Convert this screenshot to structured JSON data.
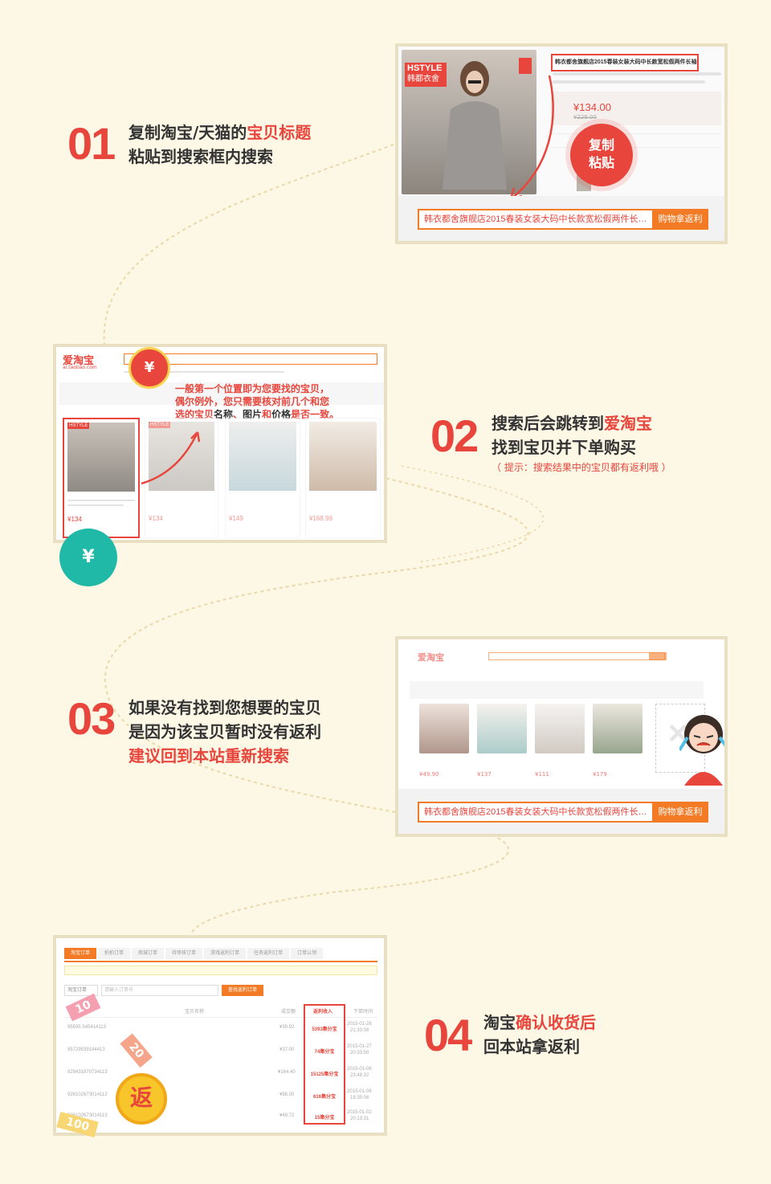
{
  "colors": {
    "accent": "#e8463c",
    "orange": "#f47b26",
    "background": "#fdf7e6",
    "frame": "#e9dfc2",
    "teal": "#20b9a8"
  },
  "step1": {
    "number": "01",
    "line1_prefix": "复制淘宝/天猫的",
    "line1_highlight": "宝贝标题",
    "line2": "粘贴到搜索框内搜索",
    "screenshot": {
      "brand_line1": "HSTYLE",
      "brand_line2": "韩都衣舍",
      "product_title": "韩衣都舍旗舰店2015春装女装大码中长款宽松假两件长袖针织衫潮",
      "price": "¥134.00",
      "old_price": "¥228.00",
      "copy_label_line1": "复制",
      "copy_label_line2": "粘贴",
      "search_value": "韩衣都舍旗舰店2015春装女装大码中长款宽松假两件长袖针织...",
      "search_button": "购物拿返利"
    }
  },
  "step2": {
    "number": "02",
    "line1_prefix": "搜索后会跳转到",
    "line1_highlight": "爱淘宝",
    "line2": "找到宝贝并下单购买",
    "hint": "（ 提示：搜索结果中的宝贝都有返利哦 ）",
    "screenshot": {
      "logo": "爱淘宝",
      "logo_sub": "ai.taobao.com",
      "note_line1": "一般第一个位置即为您要找的宝贝，",
      "note_line2": "偶尔例外，您只需要核对前几个和您",
      "note_line3_a": "选的宝贝",
      "note_line3_b": "名称",
      "note_line3_c": "、",
      "note_line3_d": "图片",
      "note_line3_e": "和",
      "note_line3_f": "价格",
      "note_line3_g": "是否一致。",
      "products": [
        {
          "price": "¥134",
          "brand": "HSTYLE"
        },
        {
          "price": "¥134",
          "brand": "HSTYLE"
        },
        {
          "price": "¥149",
          "brand": ""
        },
        {
          "price": "¥168.99",
          "brand": ""
        }
      ]
    }
  },
  "step3": {
    "number": "03",
    "line1": "如果没有找到您想要的宝贝",
    "line2": "是因为该宝贝暂时没有返利",
    "line3": "建议回到本站重新搜索",
    "screenshot": {
      "logo": "爱淘宝",
      "search_value": "韩衣都舍旗舰店2015春装女装大码中长款宽松假两件长袖针织...",
      "search_button": "购物拿返利",
      "prices": [
        "¥49.90",
        "¥137",
        "¥111",
        "¥179"
      ]
    }
  },
  "step4": {
    "number": "04",
    "line1_prefix": "淘宝",
    "line1_highlight": "确认收货后",
    "line2": "回本站拿返利",
    "screenshot": {
      "tabs": [
        "淘宝订单",
        "拍拍订单",
        "商城订单",
        "待审核订单",
        "游戏返利订单",
        "任务返利订单",
        "订单认领"
      ],
      "filter_label": "淘宝订单",
      "filter_placeholder": "请输入订单号",
      "filter_button": "查找返利订单",
      "col_name": "宝贝名称",
      "col_amount": "成交额",
      "col_rebate": "返利收入",
      "col_time": "下单时间",
      "rows": [
        {
          "id": "95595 545414113",
          "amount": "¥39.92",
          "rebate": "5393集分宝",
          "date": "2015-01-28",
          "time": "21:33:08"
        },
        {
          "id": "95729539144413",
          "amount": "¥37.00",
          "rebate": "74集分宝",
          "date": "2015-01-27",
          "time": "20:33:50"
        },
        {
          "id": "929431870734113",
          "amount": "¥164.40",
          "rebate": "15125集分宝",
          "date": "2015-01-08",
          "time": "23:48:32"
        },
        {
          "id": "926102673014113",
          "amount": "¥88.00",
          "rebate": "616集分宝",
          "date": "2015-01-06",
          "time": "19:35:06"
        },
        {
          "id": "926102673014113",
          "amount": "¥49.72",
          "rebate": "15集分宝",
          "date": "2015-01-02",
          "time": "20:13:31"
        }
      ],
      "coin_label": "返",
      "ribbons": [
        "10",
        "20",
        "100"
      ]
    }
  }
}
